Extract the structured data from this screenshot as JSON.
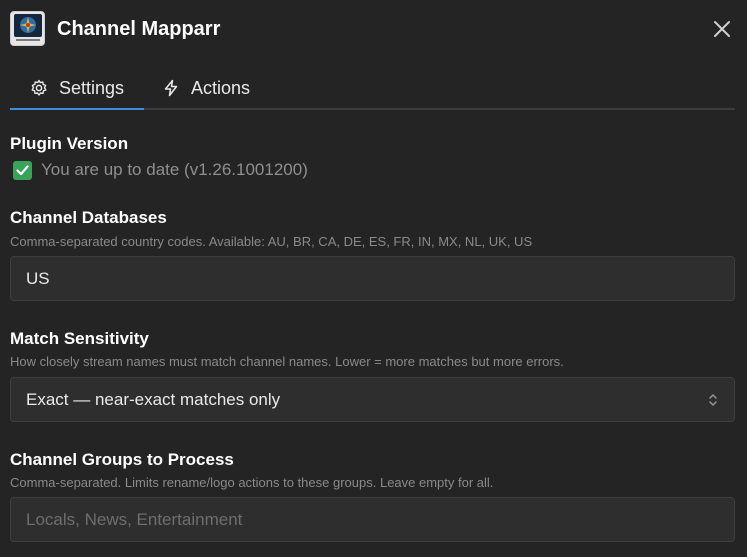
{
  "app": {
    "title": "Channel Mapparr"
  },
  "tabs": [
    {
      "label": "Settings",
      "icon": "gear-icon",
      "active": true
    },
    {
      "label": "Actions",
      "icon": "lightning-icon",
      "active": false
    }
  ],
  "plugin_version": {
    "label": "Plugin Version",
    "status": "You are up to date (v1.26.1001200)",
    "status_icon": "check-icon",
    "status_color": "#3aa35b"
  },
  "channel_databases": {
    "label": "Channel Databases",
    "description": "Comma-separated country codes. Available: AU, BR, CA, DE, ES, FR, IN, MX, NL, UK, US",
    "value": "US"
  },
  "match_sensitivity": {
    "label": "Match Sensitivity",
    "description": "How closely stream names must match channel names. Lower = more matches but more errors.",
    "selected": "Exact — near-exact matches only"
  },
  "channel_groups": {
    "label": "Channel Groups to Process",
    "description": "Comma-separated. Limits rename/logo actions to these groups. Leave empty for all.",
    "value": "",
    "placeholder": "Locals, News, Entertainment"
  },
  "colors": {
    "background": "#242424",
    "accent": "#3d8ddb"
  }
}
